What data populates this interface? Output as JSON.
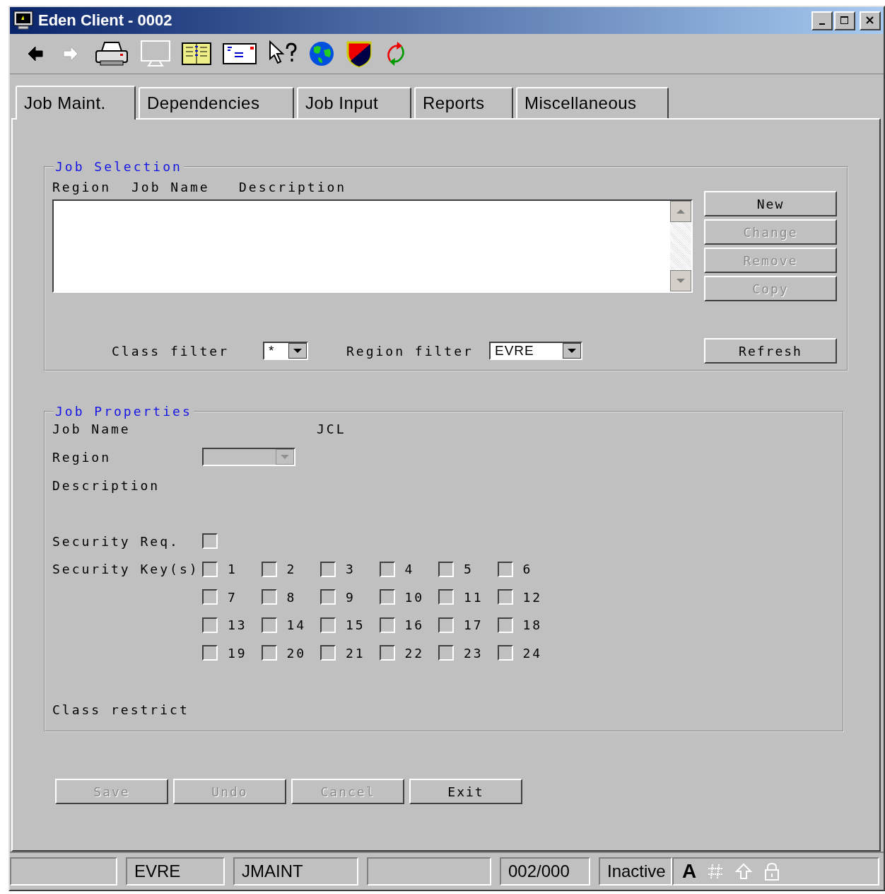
{
  "window": {
    "title": "Eden Client - 0002"
  },
  "toolbar": [
    {
      "kind": "back",
      "disabled": false
    },
    {
      "kind": "forward",
      "disabled": true
    },
    {
      "kind": "printer",
      "disabled": false
    },
    {
      "kind": "monitor",
      "disabled": true
    },
    {
      "kind": "book",
      "disabled": false
    },
    {
      "kind": "envelope",
      "disabled": false
    },
    {
      "kind": "help",
      "disabled": false
    },
    {
      "kind": "globe",
      "disabled": false
    },
    {
      "kind": "shield",
      "disabled": false
    },
    {
      "kind": "refresh",
      "disabled": false
    }
  ],
  "tabs": [
    {
      "label": "Job Maint.",
      "selected": true
    },
    {
      "label": "Dependencies",
      "selected": false
    },
    {
      "label": "Job Input",
      "selected": false
    },
    {
      "label": "Reports",
      "selected": false
    },
    {
      "label": "Miscellaneous",
      "selected": false
    }
  ],
  "job_selection": {
    "title": "Job Selection",
    "columns": [
      "Region",
      "Job Name",
      "Description"
    ],
    "buttons": [
      {
        "label": "New",
        "disabled": false
      },
      {
        "label": "Change",
        "disabled": true
      },
      {
        "label": "Remove",
        "disabled": true
      },
      {
        "label": "Copy",
        "disabled": true
      }
    ],
    "class_filter": {
      "label": "Class filter",
      "value": "*"
    },
    "region_filter": {
      "label": "Region filter",
      "value": "EVRE"
    },
    "refresh": {
      "label": "Refresh",
      "disabled": false
    }
  },
  "job_properties": {
    "title": "Job Properties",
    "job_name_label": "Job Name",
    "jcl_label": "JCL",
    "region_label": "Region",
    "region_disabled": true,
    "description_label": "Description",
    "security_req": {
      "label": "Security Req.",
      "checked": false
    },
    "security_keys": {
      "label": "Security Key(s)",
      "keys": [
        {
          "label": "1",
          "checked": false
        },
        {
          "label": "2",
          "checked": false
        },
        {
          "label": "3",
          "checked": false
        },
        {
          "label": "4",
          "checked": false
        },
        {
          "label": "5",
          "checked": false
        },
        {
          "label": "6",
          "checked": false
        },
        {
          "label": "7",
          "checked": false
        },
        {
          "label": "8",
          "checked": false
        },
        {
          "label": "9",
          "checked": false
        },
        {
          "label": "10",
          "checked": false
        },
        {
          "label": "11",
          "checked": false
        },
        {
          "label": "12",
          "checked": false
        },
        {
          "label": "13",
          "checked": false
        },
        {
          "label": "14",
          "checked": false
        },
        {
          "label": "15",
          "checked": false
        },
        {
          "label": "16",
          "checked": false
        },
        {
          "label": "17",
          "checked": false
        },
        {
          "label": "18",
          "checked": false
        },
        {
          "label": "19",
          "checked": false
        },
        {
          "label": "20",
          "checked": false
        },
        {
          "label": "21",
          "checked": false
        },
        {
          "label": "22",
          "checked": false
        },
        {
          "label": "23",
          "checked": false
        },
        {
          "label": "24",
          "checked": false
        }
      ]
    },
    "class_restrict_label": "Class restrict"
  },
  "footer_buttons": [
    {
      "label": "Save",
      "disabled": true
    },
    {
      "label": "Undo",
      "disabled": true
    },
    {
      "label": "Cancel",
      "disabled": true
    },
    {
      "label": "Exit",
      "disabled": false
    }
  ],
  "status_bar": {
    "panels": [
      {
        "kind": "empty"
      },
      {
        "kind": "text",
        "text": "EVRE"
      },
      {
        "kind": "text",
        "text": "JMAINT"
      },
      {
        "kind": "empty"
      },
      {
        "kind": "text",
        "text": "002/000"
      },
      {
        "kind": "text",
        "text": "Inactive"
      }
    ],
    "indicators": [
      {
        "kind": "caps",
        "label": "A",
        "on": true
      },
      {
        "kind": "num",
        "on": false
      },
      {
        "kind": "shift",
        "on": false
      },
      {
        "kind": "lock",
        "on": false
      }
    ]
  }
}
